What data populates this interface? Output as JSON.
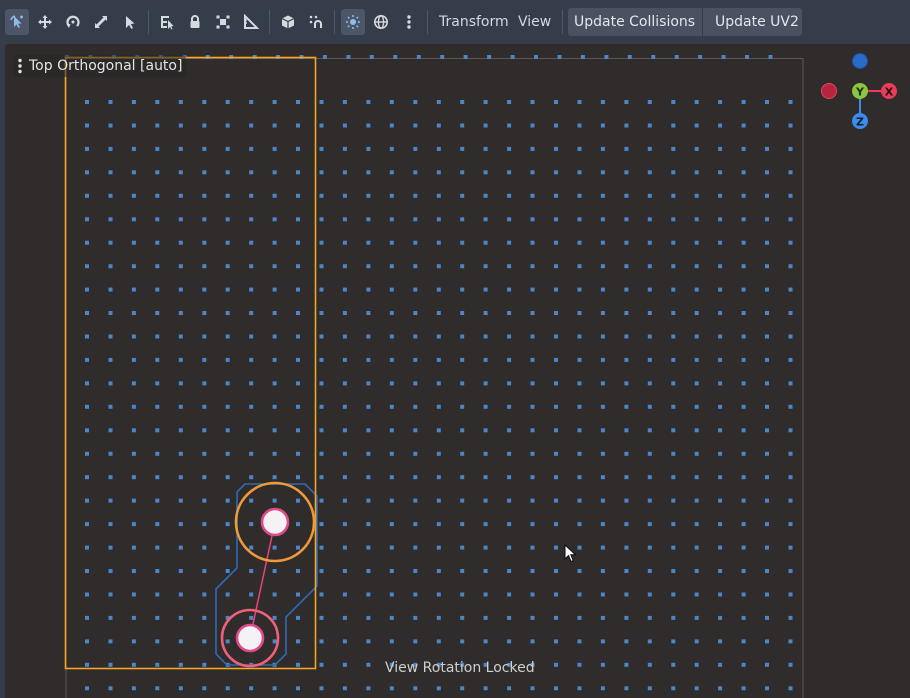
{
  "toolbar": {
    "tools": [
      {
        "id": "select",
        "icon": "select-mode-icon",
        "active": true
      },
      {
        "id": "move",
        "icon": "move-mode-icon"
      },
      {
        "id": "rotate",
        "icon": "rotate-mode-icon"
      },
      {
        "id": "scale",
        "icon": "scale-mode-icon"
      },
      {
        "id": "list-select",
        "icon": "list-select-icon"
      },
      {
        "id": "pivot",
        "icon": "pivot-icon"
      },
      {
        "id": "lock",
        "icon": "lock-icon"
      },
      {
        "id": "group",
        "icon": "group-icon"
      },
      {
        "id": "ruler",
        "icon": "ruler-icon"
      },
      {
        "id": "local-space",
        "icon": "local-space-icon"
      },
      {
        "id": "snap",
        "icon": "snap-icon"
      },
      {
        "id": "sun",
        "icon": "sun-icon",
        "active": true
      },
      {
        "id": "environment",
        "icon": "globe-icon"
      },
      {
        "id": "more",
        "icon": "more-options-icon"
      }
    ],
    "menus": [
      "Transform",
      "View"
    ],
    "actions": [
      "Update Collisions",
      "Update UV2"
    ]
  },
  "viewport": {
    "view_label": "Top Orthogonal [auto]",
    "status": "View Rotation Locked",
    "gizmo": {
      "y_label": "Y",
      "x_label": "X",
      "z_label": "Z"
    }
  },
  "colors": {
    "toolbar_bg": "#363d4a",
    "viewport_bg": "#2f2c2b",
    "grid_dot": "#4a86c8",
    "selection": "#f5a623",
    "handle_ring": "#ef9a3a",
    "handle_ring_pink": "#f0607a",
    "handle_fill": "#f4f2f4",
    "axis_x": "#ea3d5a",
    "axis_y": "#8cc63f",
    "axis_z": "#3d8bea",
    "capsule_outline": "#2e6ab8"
  }
}
